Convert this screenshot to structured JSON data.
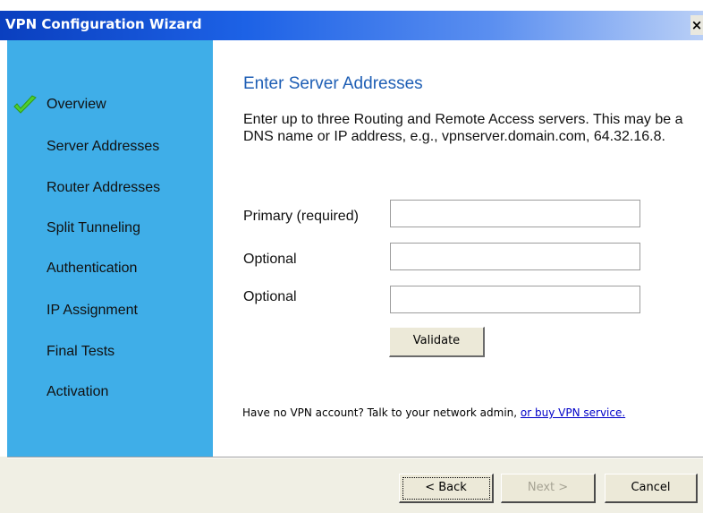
{
  "window": {
    "title": "VPN Configuration Wizard",
    "close_label": "×"
  },
  "sidebar": {
    "steps": [
      {
        "label": "Overview",
        "completed": true
      },
      {
        "label": "Server Addresses",
        "completed": false
      },
      {
        "label": "Router Addresses",
        "completed": false
      },
      {
        "label": "Split Tunneling",
        "completed": false
      },
      {
        "label": "Authentication",
        "completed": false
      },
      {
        "label": "IP Assignment",
        "completed": false
      },
      {
        "label": "Final Tests",
        "completed": false
      },
      {
        "label": "Activation",
        "completed": false
      }
    ],
    "check_icon": "checkmark-icon"
  },
  "main": {
    "heading": "Enter Server Addresses",
    "description": "Enter up to three Routing and Remote Access servers.  This may be a DNS name or IP address, e.g., vpnserver.domain.com, 64.32.16.8.",
    "fields": [
      {
        "label": "Primary (required)",
        "value": ""
      },
      {
        "label": "Optional",
        "value": ""
      },
      {
        "label": "Optional",
        "value": ""
      }
    ],
    "validate_label": "Validate",
    "note_text": "Have no VPN account? Talk to your network admin, ",
    "note_link": "or buy VPN service."
  },
  "footer": {
    "back_label": "< Back",
    "next_label": "Next >",
    "cancel_label": "Cancel"
  },
  "colors": {
    "sidebar": "#3faee8",
    "heading": "#1f5fb5",
    "titlebar": "#1d62e6",
    "link": "#0000c8"
  }
}
